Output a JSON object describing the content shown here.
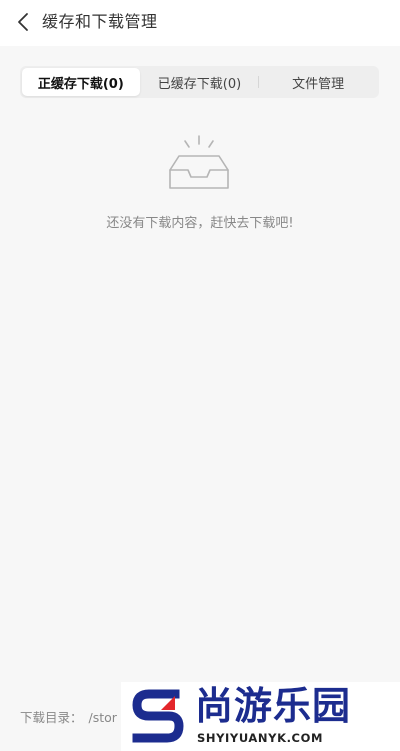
{
  "header": {
    "title": "缓存和下载管理"
  },
  "tabs": [
    {
      "label": "正缓存下载(0)",
      "active": true
    },
    {
      "label": "已缓存下载(0)",
      "active": false
    },
    {
      "label": "文件管理",
      "active": false
    }
  ],
  "empty_state": {
    "message": "还没有下载内容，赶快去下载吧!"
  },
  "footer": {
    "path_label": "下载目录：",
    "path_value": "/stor"
  },
  "watermark": {
    "title": "尚游乐园",
    "domain": "SHYIYUANYK.COM"
  },
  "colors": {
    "background": "#f7f7f7",
    "header_bg": "#ffffff",
    "tab_bar_bg": "#eeeeee",
    "text_primary": "#333333",
    "text_muted": "#888888",
    "watermark_blue": "#1c2c8f",
    "watermark_red": "#e3262b"
  }
}
